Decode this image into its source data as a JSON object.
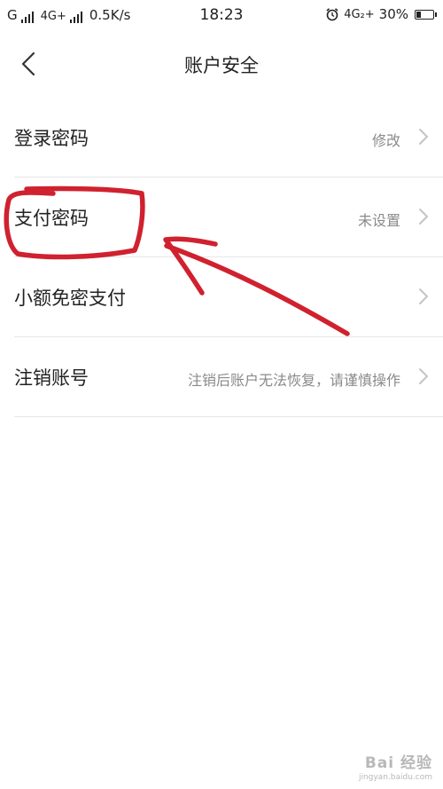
{
  "status_bar": {
    "sim1_network": "G",
    "sim2_network": "4G+",
    "speed": "0.5K/s",
    "time": "18:23",
    "right_network": "4G₂+",
    "battery_percent": 30,
    "battery_text": "30%",
    "icons": [
      "signal-icon",
      "signal-icon",
      "alarm-icon",
      "battery-icon"
    ]
  },
  "nav": {
    "back_icon": "chevron-left-icon",
    "title": "账户安全"
  },
  "settings": {
    "items": [
      {
        "label": "登录密码",
        "value": "修改",
        "icon": "chevron-right-icon"
      },
      {
        "label": "支付密码",
        "value": "未设置",
        "icon": "chevron-right-icon"
      },
      {
        "label": "小额免密支付",
        "value": "",
        "icon": "chevron-right-icon"
      },
      {
        "label": "注销账号",
        "value": "注销后账户无法恢复，请谨慎操作",
        "icon": "chevron-right-icon"
      }
    ]
  },
  "annotation": {
    "color": "#d0212f",
    "target": "支付密码"
  },
  "watermark": {
    "brand": "Bai 经验",
    "url": "jingyan.baidu.com"
  }
}
